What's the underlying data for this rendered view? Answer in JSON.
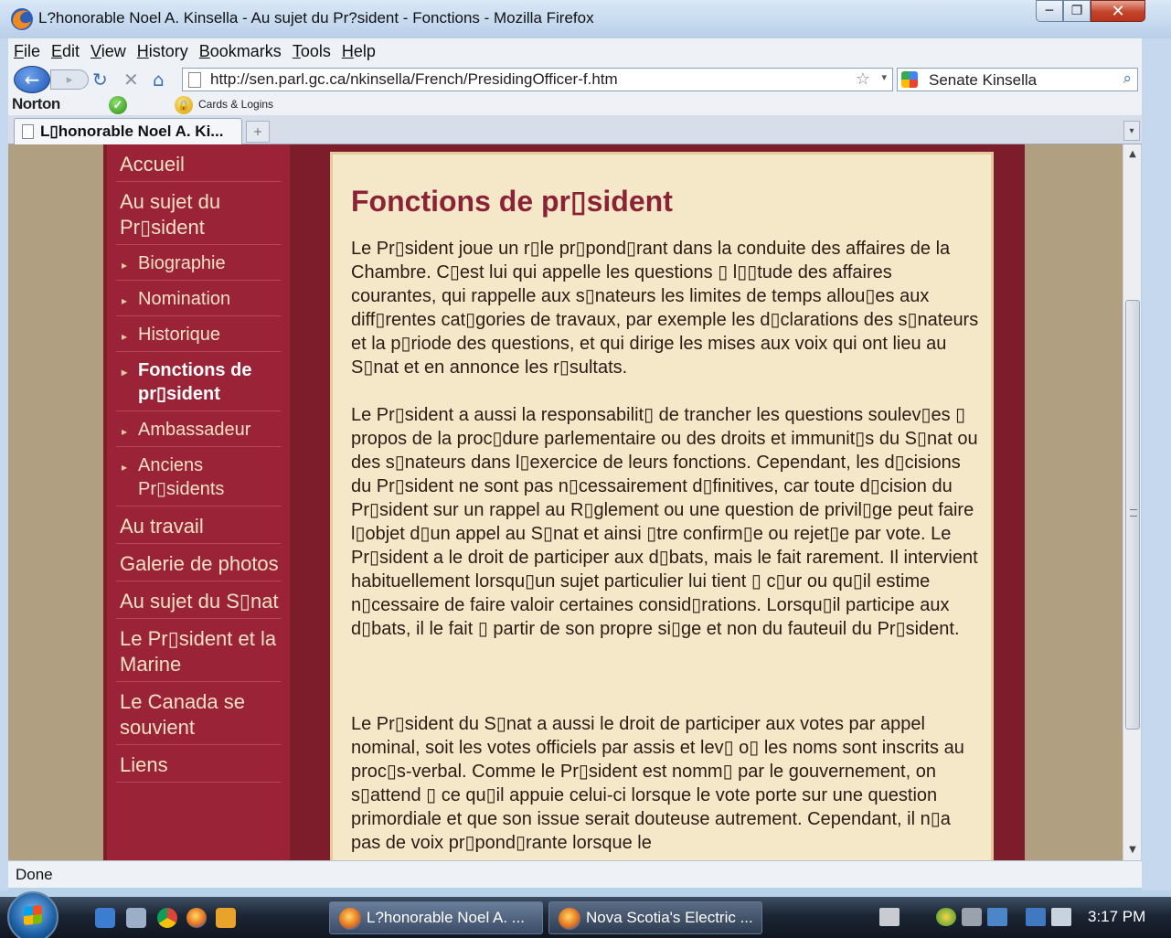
{
  "window": {
    "title": "L?honorable Noel A. Kinsella - Au sujet du Pr?sident - Fonctions - Mozilla Firefox",
    "minimize_glyph": "─",
    "restore_glyph": "❐",
    "close_glyph": "✕"
  },
  "menu": [
    "File",
    "Edit",
    "View",
    "History",
    "Bookmarks",
    "Tools",
    "Help"
  ],
  "navbar": {
    "back_glyph": "←",
    "forward_glyph": "▸",
    "reload_glyph": "↻",
    "stop_glyph": "✕",
    "home_glyph": "⌂",
    "url": "http://sen.parl.gc.ca/nkinsella/French/PresidingOfficer-f.htm",
    "star_glyph": "☆",
    "dropdown_glyph": "▾",
    "search_value": "Senate Kinsella",
    "search_glyph": "⌕"
  },
  "norton": {
    "logo": "Norton",
    "check_glyph": "✓",
    "cards_label": "Cards & Logins"
  },
  "tabs": {
    "active_label": "L▯honorable Noel A. Ki...",
    "new_tab_glyph": "+",
    "list_glyph": "▾"
  },
  "sidebar": {
    "items": [
      {
        "label": "Accueil",
        "type": "top"
      },
      {
        "label": "Au sujet du Pr▯sident",
        "type": "top"
      },
      {
        "label": "Biographie",
        "type": "sub"
      },
      {
        "label": "Nomination",
        "type": "sub"
      },
      {
        "label": "Historique",
        "type": "sub"
      },
      {
        "label": "Fonctions de pr▯sident",
        "type": "sub",
        "active": true
      },
      {
        "label": "Ambassadeur",
        "type": "sub"
      },
      {
        "label": "Anciens Pr▯sidents",
        "type": "sub"
      },
      {
        "label": "Au travail",
        "type": "top"
      },
      {
        "label": "Galerie de photos",
        "type": "top"
      },
      {
        "label": "Au sujet du S▯nat",
        "type": "top"
      },
      {
        "label": "Le Pr▯sident et la Marine",
        "type": "top"
      },
      {
        "label": "Le Canada se souvient",
        "type": "top"
      },
      {
        "label": "Liens",
        "type": "top"
      }
    ]
  },
  "content": {
    "heading": "Fonctions de pr▯sident",
    "paragraphs": [
      "Le Pr▯sident joue un r▯le pr▯pond▯rant dans la conduite des affaires de la Chambre. C▯est lui qui appelle les questions ▯ l▯▯tude des affaires courantes, qui rappelle aux s▯nateurs les limites de temps allou▯es aux diff▯rentes cat▯gories de travaux, par exemple les d▯clarations des s▯nateurs et la p▯riode des questions, et qui dirige les mises aux voix qui ont lieu au S▯nat et en annonce les r▯sultats.",
      "Le Pr▯sident a aussi la responsabilit▯ de trancher les questions soulev▯es ▯ propos de la proc▯dure parlementaire ou des droits et immunit▯s du S▯nat ou des s▯nateurs dans l▯exercice de leurs fonctions. Cependant, les d▯cisions du Pr▯sident ne sont pas n▯cessairement d▯finitives, car toute d▯cision du Pr▯sident sur un rappel au R▯glement ou une question de privil▯ge peut faire l▯objet d▯un appel au S▯nat et ainsi ▯tre confirm▯e ou rejet▯e par vote. Le Pr▯sident a le droit de participer aux d▯bats, mais le fait rarement. Il intervient habituellement lorsqu▯un sujet particulier lui tient ▯ c▯ur ou qu▯il estime n▯cessaire de faire valoir certaines consid▯rations. Lorsqu▯il participe aux d▯bats, il le fait ▯ partir de son propre si▯ge et non du fauteuil du Pr▯sident.",
      "Le Pr▯sident du S▯nat a aussi le droit de participer aux votes par appel nominal, soit les votes officiels par assis et lev▯ o▯ les noms sont inscrits au proc▯s-verbal. Comme le Pr▯sident est nomm▯ par le gouvernement, on s▯attend ▯ ce qu▯il appuie celui-ci lorsque le vote porte sur une question primordiale et que son issue serait douteuse autrement. Cependant, il n▯a pas de voix pr▯pond▯rante lorsque le"
    ]
  },
  "scrollbar": {
    "up_glyph": "▲",
    "down_glyph": "▼"
  },
  "status": "Done",
  "taskbar": {
    "tasks": [
      "L?honorable Noel A. ...",
      "Nova Scotia's Electric ..."
    ],
    "clock": "3:17 PM"
  }
}
